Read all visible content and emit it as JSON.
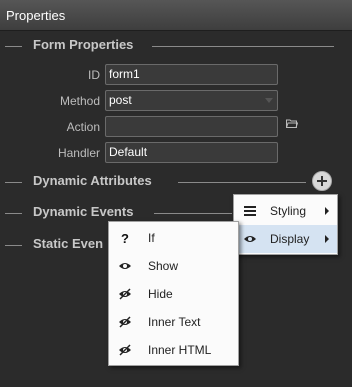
{
  "window": {
    "title": "Properties"
  },
  "sections": {
    "form": "Form Properties",
    "attributes": "Dynamic Attributes",
    "events": "Dynamic Events",
    "static": "Static Even"
  },
  "fields": {
    "id": {
      "label": "ID",
      "value": "form1"
    },
    "method": {
      "label": "Method",
      "value": "post"
    },
    "action": {
      "label": "Action",
      "value": ""
    },
    "handler": {
      "label": "Handler",
      "value": "Default"
    }
  },
  "context_menu": {
    "items": [
      {
        "label": "Styling",
        "icon": "hamburger-icon"
      },
      {
        "label": "Display",
        "icon": "eye-icon"
      }
    ]
  },
  "submenu": {
    "items": [
      {
        "label": "If",
        "icon": "question-icon"
      },
      {
        "label": "Show",
        "icon": "eye-icon"
      },
      {
        "label": "Hide",
        "icon": "eye-slash-icon"
      },
      {
        "label": "Inner Text",
        "icon": "eye-slash-icon"
      },
      {
        "label": "Inner HTML",
        "icon": "eye-slash-icon"
      }
    ]
  },
  "colors": {
    "panel_bg": "#2b2b2b",
    "menu_bg": "#fbfbfb",
    "menu_highlight": "#d5e3f2"
  }
}
